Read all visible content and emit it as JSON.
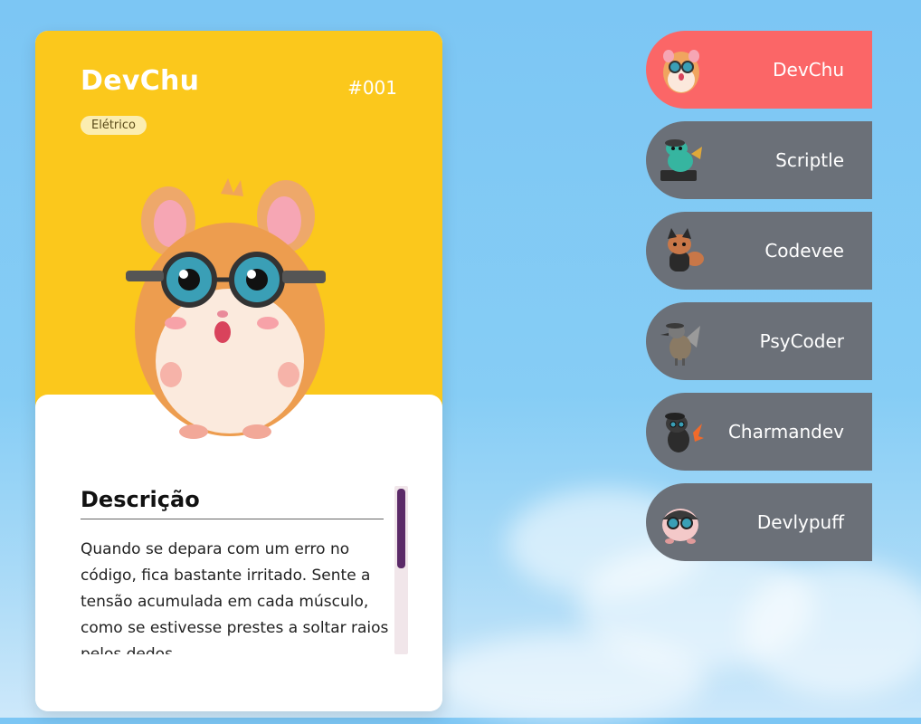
{
  "card": {
    "name": "DevChu",
    "number": "#001",
    "type": "Elétrico",
    "description_title": "Descrição",
    "description": "Quando se depara com um erro no código, fica bastante irritado. Sente a tensão acumulada em cada músculo, como se estivesse prestes a soltar raios pelos dedos."
  },
  "pokemon_list": [
    {
      "name": "DevChu",
      "active": true
    },
    {
      "name": "Scriptle",
      "active": false
    },
    {
      "name": "Codevee",
      "active": false
    },
    {
      "name": "PsyCoder",
      "active": false
    },
    {
      "name": "Charmandev",
      "active": false
    },
    {
      "name": "Devlypuff",
      "active": false
    }
  ],
  "colors": {
    "background": "#7cc6f4",
    "card_top": "#fbc81c",
    "active_item": "#fb6667",
    "inactive_item": "#6b7078",
    "scrollbar_thumb": "#5b2a68"
  }
}
